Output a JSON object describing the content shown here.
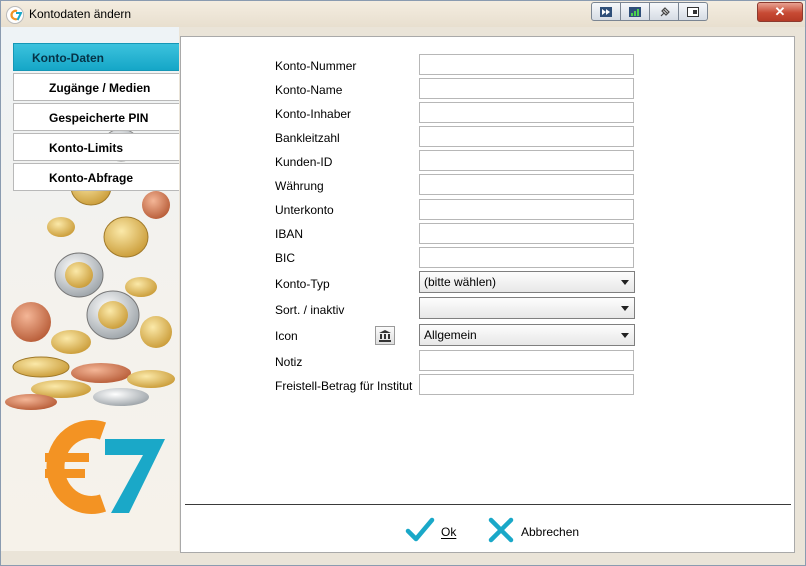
{
  "window": {
    "title": "Kontodaten ändern",
    "close_label": "✕"
  },
  "tabs": [
    {
      "label": "Konto-Daten",
      "active": true
    },
    {
      "label": "Zugänge / Medien",
      "active": false
    },
    {
      "label": "Gespeicherte PIN",
      "active": false
    },
    {
      "label": "Konto-Limits",
      "active": false
    },
    {
      "label": "Konto-Abfrage",
      "active": false
    }
  ],
  "form": {
    "konto_nummer": {
      "label": "Konto-Nummer",
      "value": ""
    },
    "konto_name": {
      "label": "Konto-Name",
      "value": ""
    },
    "konto_inhaber": {
      "label": "Konto-Inhaber",
      "value": ""
    },
    "bankleitzahl": {
      "label": "Bankleitzahl",
      "value": ""
    },
    "kunden_id": {
      "label": "Kunden-ID",
      "value": ""
    },
    "waehrung": {
      "label": "Währung",
      "value": ""
    },
    "unterkonto": {
      "label": "Unterkonto",
      "value": ""
    },
    "iban": {
      "label": "IBAN",
      "value": ""
    },
    "bic": {
      "label": "BIC",
      "value": ""
    },
    "konto_typ": {
      "label": "Konto-Typ",
      "selected": "(bitte wählen)"
    },
    "sort_inaktiv": {
      "label": "Sort. / inaktiv",
      "selected": ""
    },
    "icon": {
      "label": "Icon",
      "selected": "Allgemein",
      "icon_name": "bank-icon"
    },
    "notiz": {
      "label": "Notiz",
      "value": ""
    },
    "freistell": {
      "label": "Freistell-Betrag für Institut",
      "value": ""
    }
  },
  "actions": {
    "ok_label": "Ok",
    "cancel_label": "Abbrechen"
  },
  "colors": {
    "accent": "#1aa8c8",
    "logo_orange": "#f39323",
    "logo_blue": "#1aa8c8"
  }
}
